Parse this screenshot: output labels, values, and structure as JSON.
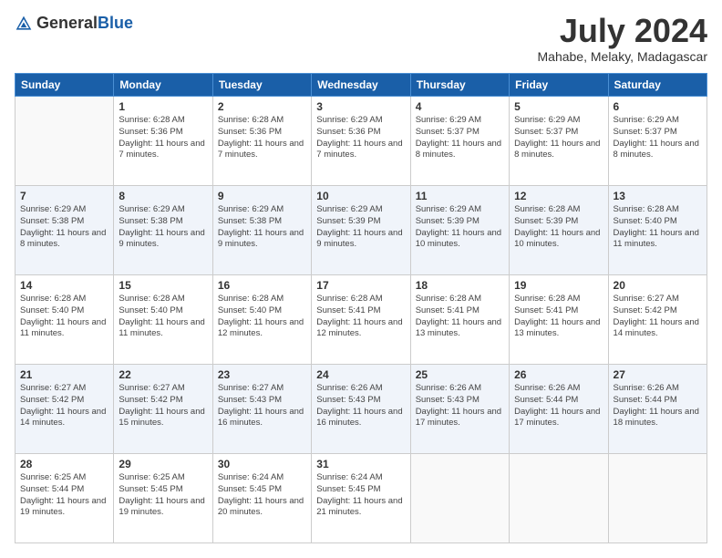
{
  "header": {
    "logo_general": "General",
    "logo_blue": "Blue",
    "month_title": "July 2024",
    "location": "Mahabe, Melaky, Madagascar"
  },
  "days_of_week": [
    "Sunday",
    "Monday",
    "Tuesday",
    "Wednesday",
    "Thursday",
    "Friday",
    "Saturday"
  ],
  "weeks": [
    [
      {
        "num": "",
        "sunrise": "",
        "sunset": "",
        "daylight": ""
      },
      {
        "num": "1",
        "sunrise": "Sunrise: 6:28 AM",
        "sunset": "Sunset: 5:36 PM",
        "daylight": "Daylight: 11 hours and 7 minutes."
      },
      {
        "num": "2",
        "sunrise": "Sunrise: 6:28 AM",
        "sunset": "Sunset: 5:36 PM",
        "daylight": "Daylight: 11 hours and 7 minutes."
      },
      {
        "num": "3",
        "sunrise": "Sunrise: 6:29 AM",
        "sunset": "Sunset: 5:36 PM",
        "daylight": "Daylight: 11 hours and 7 minutes."
      },
      {
        "num": "4",
        "sunrise": "Sunrise: 6:29 AM",
        "sunset": "Sunset: 5:37 PM",
        "daylight": "Daylight: 11 hours and 8 minutes."
      },
      {
        "num": "5",
        "sunrise": "Sunrise: 6:29 AM",
        "sunset": "Sunset: 5:37 PM",
        "daylight": "Daylight: 11 hours and 8 minutes."
      },
      {
        "num": "6",
        "sunrise": "Sunrise: 6:29 AM",
        "sunset": "Sunset: 5:37 PM",
        "daylight": "Daylight: 11 hours and 8 minutes."
      }
    ],
    [
      {
        "num": "7",
        "sunrise": "Sunrise: 6:29 AM",
        "sunset": "Sunset: 5:38 PM",
        "daylight": "Daylight: 11 hours and 8 minutes."
      },
      {
        "num": "8",
        "sunrise": "Sunrise: 6:29 AM",
        "sunset": "Sunset: 5:38 PM",
        "daylight": "Daylight: 11 hours and 9 minutes."
      },
      {
        "num": "9",
        "sunrise": "Sunrise: 6:29 AM",
        "sunset": "Sunset: 5:38 PM",
        "daylight": "Daylight: 11 hours and 9 minutes."
      },
      {
        "num": "10",
        "sunrise": "Sunrise: 6:29 AM",
        "sunset": "Sunset: 5:39 PM",
        "daylight": "Daylight: 11 hours and 9 minutes."
      },
      {
        "num": "11",
        "sunrise": "Sunrise: 6:29 AM",
        "sunset": "Sunset: 5:39 PM",
        "daylight": "Daylight: 11 hours and 10 minutes."
      },
      {
        "num": "12",
        "sunrise": "Sunrise: 6:28 AM",
        "sunset": "Sunset: 5:39 PM",
        "daylight": "Daylight: 11 hours and 10 minutes."
      },
      {
        "num": "13",
        "sunrise": "Sunrise: 6:28 AM",
        "sunset": "Sunset: 5:40 PM",
        "daylight": "Daylight: 11 hours and 11 minutes."
      }
    ],
    [
      {
        "num": "14",
        "sunrise": "Sunrise: 6:28 AM",
        "sunset": "Sunset: 5:40 PM",
        "daylight": "Daylight: 11 hours and 11 minutes."
      },
      {
        "num": "15",
        "sunrise": "Sunrise: 6:28 AM",
        "sunset": "Sunset: 5:40 PM",
        "daylight": "Daylight: 11 hours and 11 minutes."
      },
      {
        "num": "16",
        "sunrise": "Sunrise: 6:28 AM",
        "sunset": "Sunset: 5:40 PM",
        "daylight": "Daylight: 11 hours and 12 minutes."
      },
      {
        "num": "17",
        "sunrise": "Sunrise: 6:28 AM",
        "sunset": "Sunset: 5:41 PM",
        "daylight": "Daylight: 11 hours and 12 minutes."
      },
      {
        "num": "18",
        "sunrise": "Sunrise: 6:28 AM",
        "sunset": "Sunset: 5:41 PM",
        "daylight": "Daylight: 11 hours and 13 minutes."
      },
      {
        "num": "19",
        "sunrise": "Sunrise: 6:28 AM",
        "sunset": "Sunset: 5:41 PM",
        "daylight": "Daylight: 11 hours and 13 minutes."
      },
      {
        "num": "20",
        "sunrise": "Sunrise: 6:27 AM",
        "sunset": "Sunset: 5:42 PM",
        "daylight": "Daylight: 11 hours and 14 minutes."
      }
    ],
    [
      {
        "num": "21",
        "sunrise": "Sunrise: 6:27 AM",
        "sunset": "Sunset: 5:42 PM",
        "daylight": "Daylight: 11 hours and 14 minutes."
      },
      {
        "num": "22",
        "sunrise": "Sunrise: 6:27 AM",
        "sunset": "Sunset: 5:42 PM",
        "daylight": "Daylight: 11 hours and 15 minutes."
      },
      {
        "num": "23",
        "sunrise": "Sunrise: 6:27 AM",
        "sunset": "Sunset: 5:43 PM",
        "daylight": "Daylight: 11 hours and 16 minutes."
      },
      {
        "num": "24",
        "sunrise": "Sunrise: 6:26 AM",
        "sunset": "Sunset: 5:43 PM",
        "daylight": "Daylight: 11 hours and 16 minutes."
      },
      {
        "num": "25",
        "sunrise": "Sunrise: 6:26 AM",
        "sunset": "Sunset: 5:43 PM",
        "daylight": "Daylight: 11 hours and 17 minutes."
      },
      {
        "num": "26",
        "sunrise": "Sunrise: 6:26 AM",
        "sunset": "Sunset: 5:44 PM",
        "daylight": "Daylight: 11 hours and 17 minutes."
      },
      {
        "num": "27",
        "sunrise": "Sunrise: 6:26 AM",
        "sunset": "Sunset: 5:44 PM",
        "daylight": "Daylight: 11 hours and 18 minutes."
      }
    ],
    [
      {
        "num": "28",
        "sunrise": "Sunrise: 6:25 AM",
        "sunset": "Sunset: 5:44 PM",
        "daylight": "Daylight: 11 hours and 19 minutes."
      },
      {
        "num": "29",
        "sunrise": "Sunrise: 6:25 AM",
        "sunset": "Sunset: 5:45 PM",
        "daylight": "Daylight: 11 hours and 19 minutes."
      },
      {
        "num": "30",
        "sunrise": "Sunrise: 6:24 AM",
        "sunset": "Sunset: 5:45 PM",
        "daylight": "Daylight: 11 hours and 20 minutes."
      },
      {
        "num": "31",
        "sunrise": "Sunrise: 6:24 AM",
        "sunset": "Sunset: 5:45 PM",
        "daylight": "Daylight: 11 hours and 21 minutes."
      },
      {
        "num": "",
        "sunrise": "",
        "sunset": "",
        "daylight": ""
      },
      {
        "num": "",
        "sunrise": "",
        "sunset": "",
        "daylight": ""
      },
      {
        "num": "",
        "sunrise": "",
        "sunset": "",
        "daylight": ""
      }
    ]
  ]
}
